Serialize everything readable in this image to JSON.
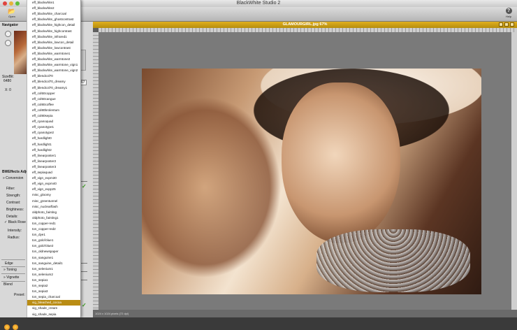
{
  "app": {
    "title": "BlackWhite Studio 2"
  },
  "toolbar": {
    "open_label": "Open",
    "help_label": "Help"
  },
  "navigator": {
    "title": "Navigator",
    "size_label": "SizeBit:",
    "size_value": "6480",
    "x_label": "X: 0"
  },
  "adjust": {
    "title": "BWEffects Adjust",
    "conversion": "Conversion",
    "fields": [
      "Filter:",
      "Strength:",
      "Contrast:",
      "Brightness:",
      "Details:"
    ],
    "black_rose": "Black Rose",
    "intensity": "Intensity:",
    "radius": "Radius:",
    "edge": "Edge",
    "toning": "Toning",
    "vignette": "Vignette",
    "blend": "Blend",
    "preset_label": "Preset:"
  },
  "zoom_value": "67",
  "presets": [
    "eff_blackwhite1",
    "eff_blackwhite2",
    "eff_blackwhite_charcoal",
    "eff_blackwhite_ghostcontrast",
    "eff_blackwhite_highcon_detail",
    "eff_blackwhite_highcontrast",
    "eff_blackwhite_infrared1",
    "eff_blackwhite_lowcon_detail",
    "eff_blackwhite_lowcontrast",
    "eff_blackwhite_warmtone1",
    "eff_blackwhite_warmtone2",
    "eff_blackwhite_warmtone_vign1",
    "eff_blackwhite_warmtone_vign2",
    "eff_blendcol70",
    "eff_blendcol70_dreamy",
    "eff_blendcol70_dreamy1",
    "eff_col50copper",
    "eff_col50cangue",
    "eff_col80coffee",
    "eff_col80brolentum",
    "eff_col80sepia",
    "eff_cyanoquad",
    "eff_cyanotype1",
    "eff_cyanotype2",
    "eff_hardlight0",
    "eff_hardlight1",
    "eff_hardlight2",
    "eff_linearposter1",
    "eff_linearposter2",
    "eff_linearposter3",
    "eff_sepiaquad",
    "eff_vign_expm30",
    "eff_vign_expm40",
    "eff_vign_expp25",
    "misc_gloomy",
    "misc_greentunnel",
    "misc_nuclearflash",
    "oldphoto_fainting",
    "oldphoto_fainting1",
    "ton_copper-red1",
    "ton_copper-red2",
    "ton_dye1",
    "ton_gold-blue1",
    "ton_gold-blue2",
    "ton_oldnewspaper",
    "ton_sanguine1",
    "ton_sanguine_detail1",
    "ton_selenium1",
    "ton_selenium2",
    "ton_sepia1",
    "ton_sepia2",
    "ton_sepia3",
    "ton_sepia_charcoal",
    "vig_bleached_cocoa",
    "vig_shade_cream",
    "vig_shade_sepia"
  ],
  "selected_preset": "vig_bleached_cocoa",
  "image_window": {
    "title": "GLAMOURGIRL.jpg 67%",
    "status": "1024 x 1024 pixels (72 dpi)"
  },
  "colors": {
    "accent": "#b98c14",
    "check": "#3a9b1e"
  }
}
